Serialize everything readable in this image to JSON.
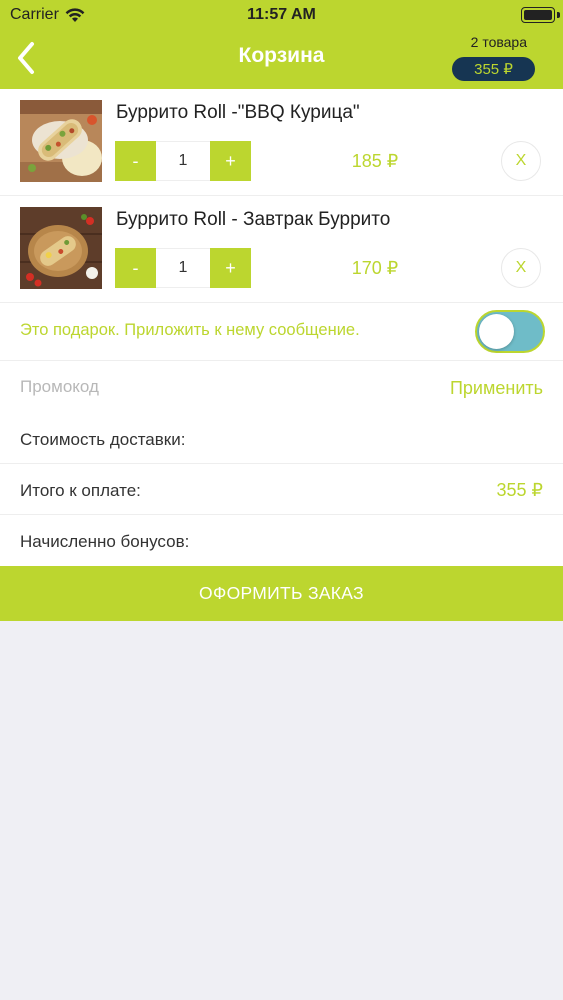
{
  "status_bar": {
    "carrier": "Carrier",
    "time": "11:57 AM"
  },
  "header": {
    "title": "Корзина",
    "items_count": "2 товара",
    "total": "355 ₽",
    "back_icon": "chevron-left-icon"
  },
  "cart": {
    "items": [
      {
        "name": "Буррито Roll -\"BBQ Курица\"",
        "minus_label": "-",
        "quantity": "1",
        "plus_label": "+",
        "price": "185 ₽",
        "remove_label": "X"
      },
      {
        "name": "Буррито Roll - Завтрак Буррито",
        "minus_label": "-",
        "quantity": "1",
        "plus_label": "+",
        "price": "170 ₽",
        "remove_label": "X"
      }
    ]
  },
  "gift": {
    "text": "Это подарок. Приложить к нему сообщение.",
    "enabled": true
  },
  "promo": {
    "placeholder": "Промокод",
    "value": "",
    "apply_label": "Применить"
  },
  "summary": {
    "delivery_label": "Стоимость доставки:",
    "delivery_value": "",
    "total_label": "Итого к оплате:",
    "total_value": "355 ₽",
    "bonus_label": "Начисленно бонусов:",
    "bonus_value": ""
  },
  "checkout": {
    "label": "ОФОРМИТЬ ЗАКАЗ"
  },
  "colors": {
    "accent": "#bcd62f",
    "badge_bg": "#163552",
    "background": "#efeff4",
    "toggle_fill": "#6fbcc8"
  }
}
